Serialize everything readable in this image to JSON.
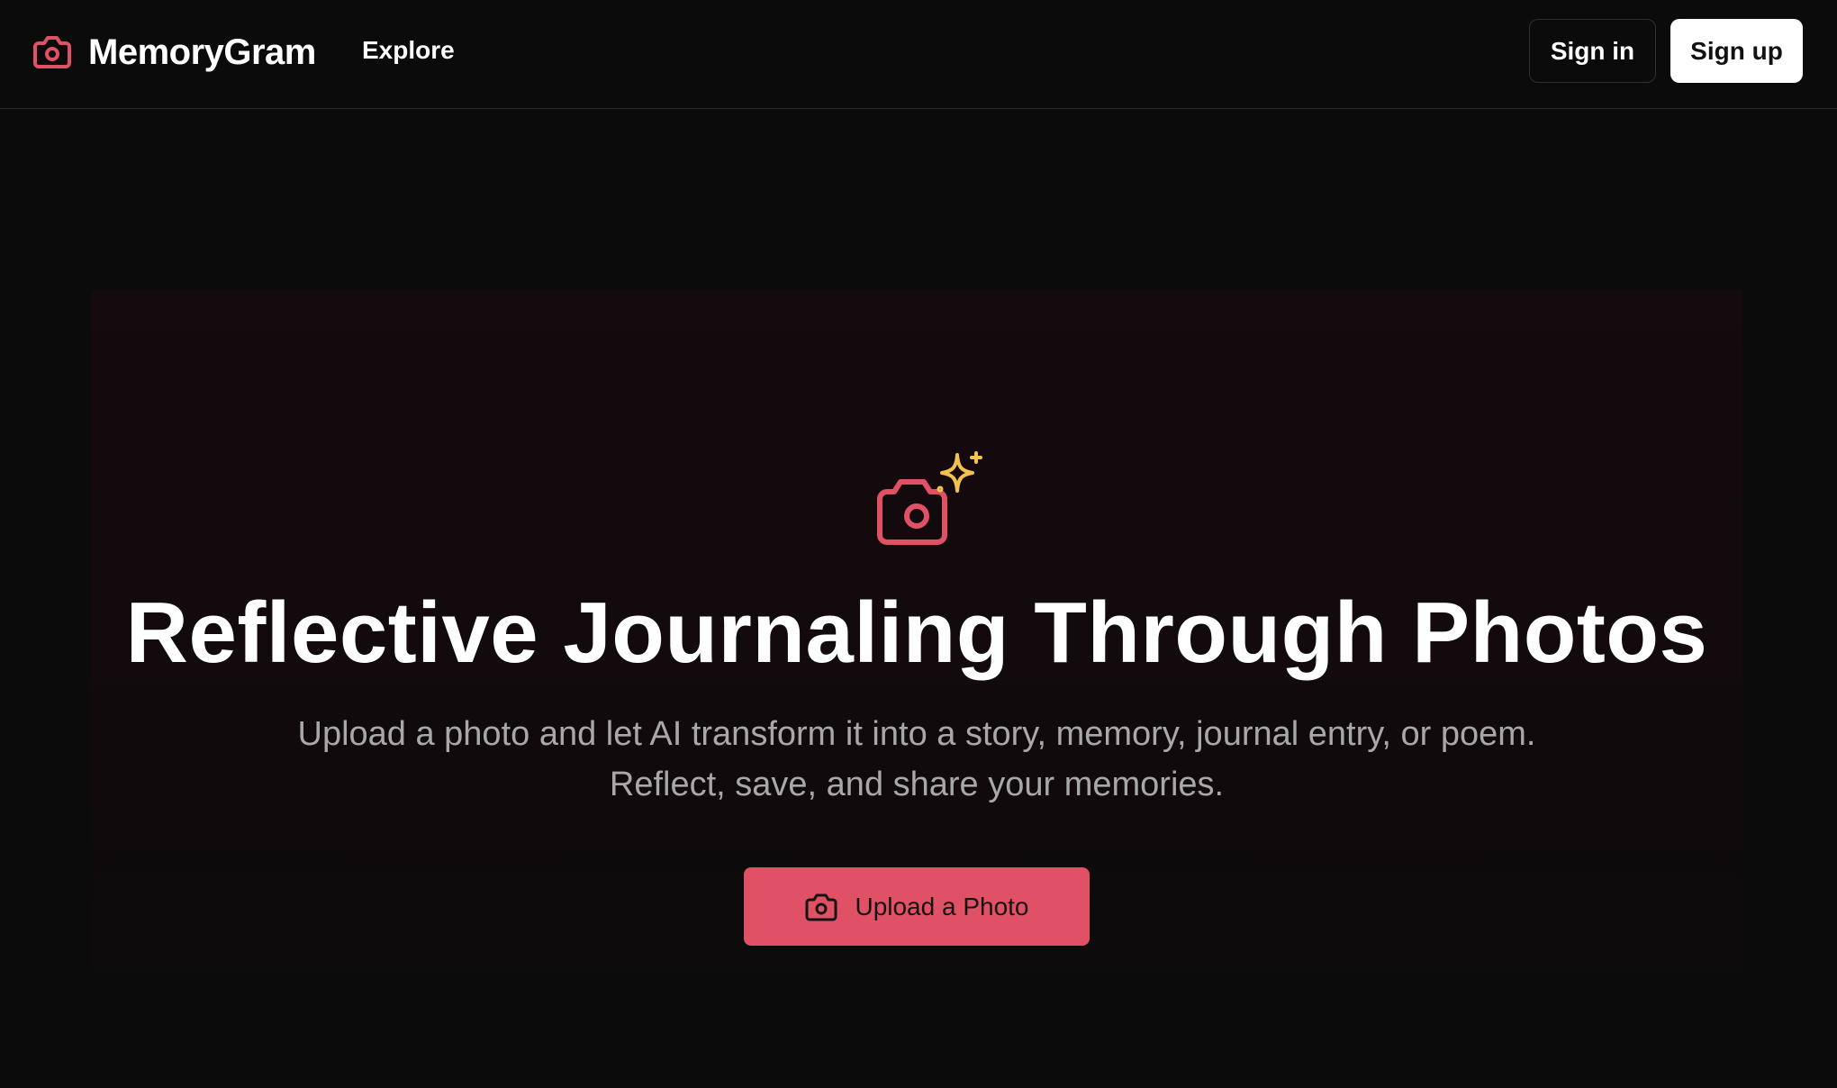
{
  "header": {
    "brand_name": "MemoryGram",
    "nav_explore": "Explore",
    "sign_in": "Sign in",
    "sign_up": "Sign up"
  },
  "hero": {
    "title": "Reflective Journaling Through Photos",
    "subtitle": "Upload a photo and let AI transform it into a story, memory, journal entry, or poem. Reflect, save, and share your memories.",
    "cta_label": "Upload a Photo"
  },
  "icons": {
    "brand": "camera-icon",
    "hero": "camera-sparkle-icon",
    "cta": "camera-icon"
  },
  "colors": {
    "accent": "#e05165",
    "sparkle": "#f2c14e",
    "background": "#0b0b0b",
    "subtitle": "#a8a8a8"
  }
}
